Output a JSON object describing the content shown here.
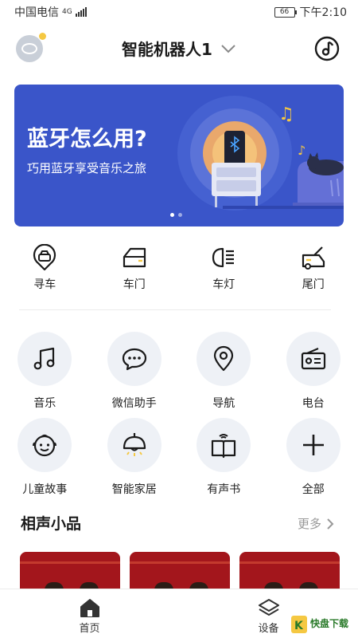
{
  "status_bar": {
    "carrier": "中国电信",
    "network": "4G",
    "battery": "66",
    "time": "下午2:10"
  },
  "header": {
    "title": "智能机器人1"
  },
  "banner": {
    "headline": "蓝牙怎么用?",
    "subtitle": "巧用蓝牙享受音乐之旅",
    "page_count": 2,
    "active_page": 1
  },
  "quick_actions": [
    {
      "label": "寻车",
      "icon": "car-locate-icon"
    },
    {
      "label": "车门",
      "icon": "car-door-icon"
    },
    {
      "label": "车灯",
      "icon": "headlight-icon"
    },
    {
      "label": "尾门",
      "icon": "tailgate-icon"
    }
  ],
  "features": [
    {
      "label": "音乐",
      "icon": "music-note-icon"
    },
    {
      "label": "微信助手",
      "icon": "chat-bubble-icon"
    },
    {
      "label": "导航",
      "icon": "location-pin-icon"
    },
    {
      "label": "电台",
      "icon": "radio-icon"
    },
    {
      "label": "儿童故事",
      "icon": "child-face-icon"
    },
    {
      "label": "智能家居",
      "icon": "ceiling-lamp-icon"
    },
    {
      "label": "有声书",
      "icon": "audiobook-icon"
    },
    {
      "label": "全部",
      "icon": "plus-icon"
    }
  ],
  "section": {
    "title": "相声小品",
    "more_label": "更多"
  },
  "bottom_nav": {
    "home_label": "首页",
    "device_label": "设备"
  },
  "watermark": {
    "text": "快盘下载"
  },
  "colors": {
    "banner": "#3a55c9",
    "accent": "#f5c842",
    "icon_bg": "#eef1f6",
    "card": "#a3161c"
  }
}
